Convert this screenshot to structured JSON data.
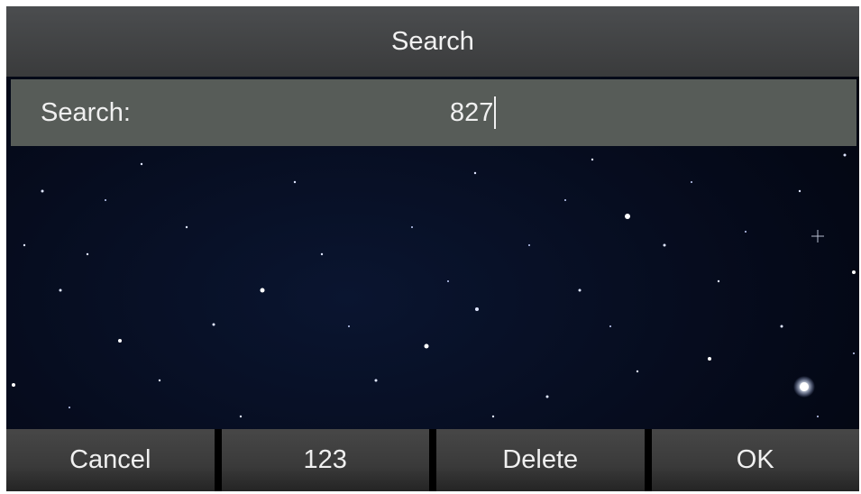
{
  "header": {
    "title": "Search"
  },
  "search": {
    "label": "Search:",
    "value": "827"
  },
  "softkeys": [
    {
      "label": "Cancel"
    },
    {
      "label": "123"
    },
    {
      "label": "Delete"
    },
    {
      "label": "OK"
    }
  ]
}
